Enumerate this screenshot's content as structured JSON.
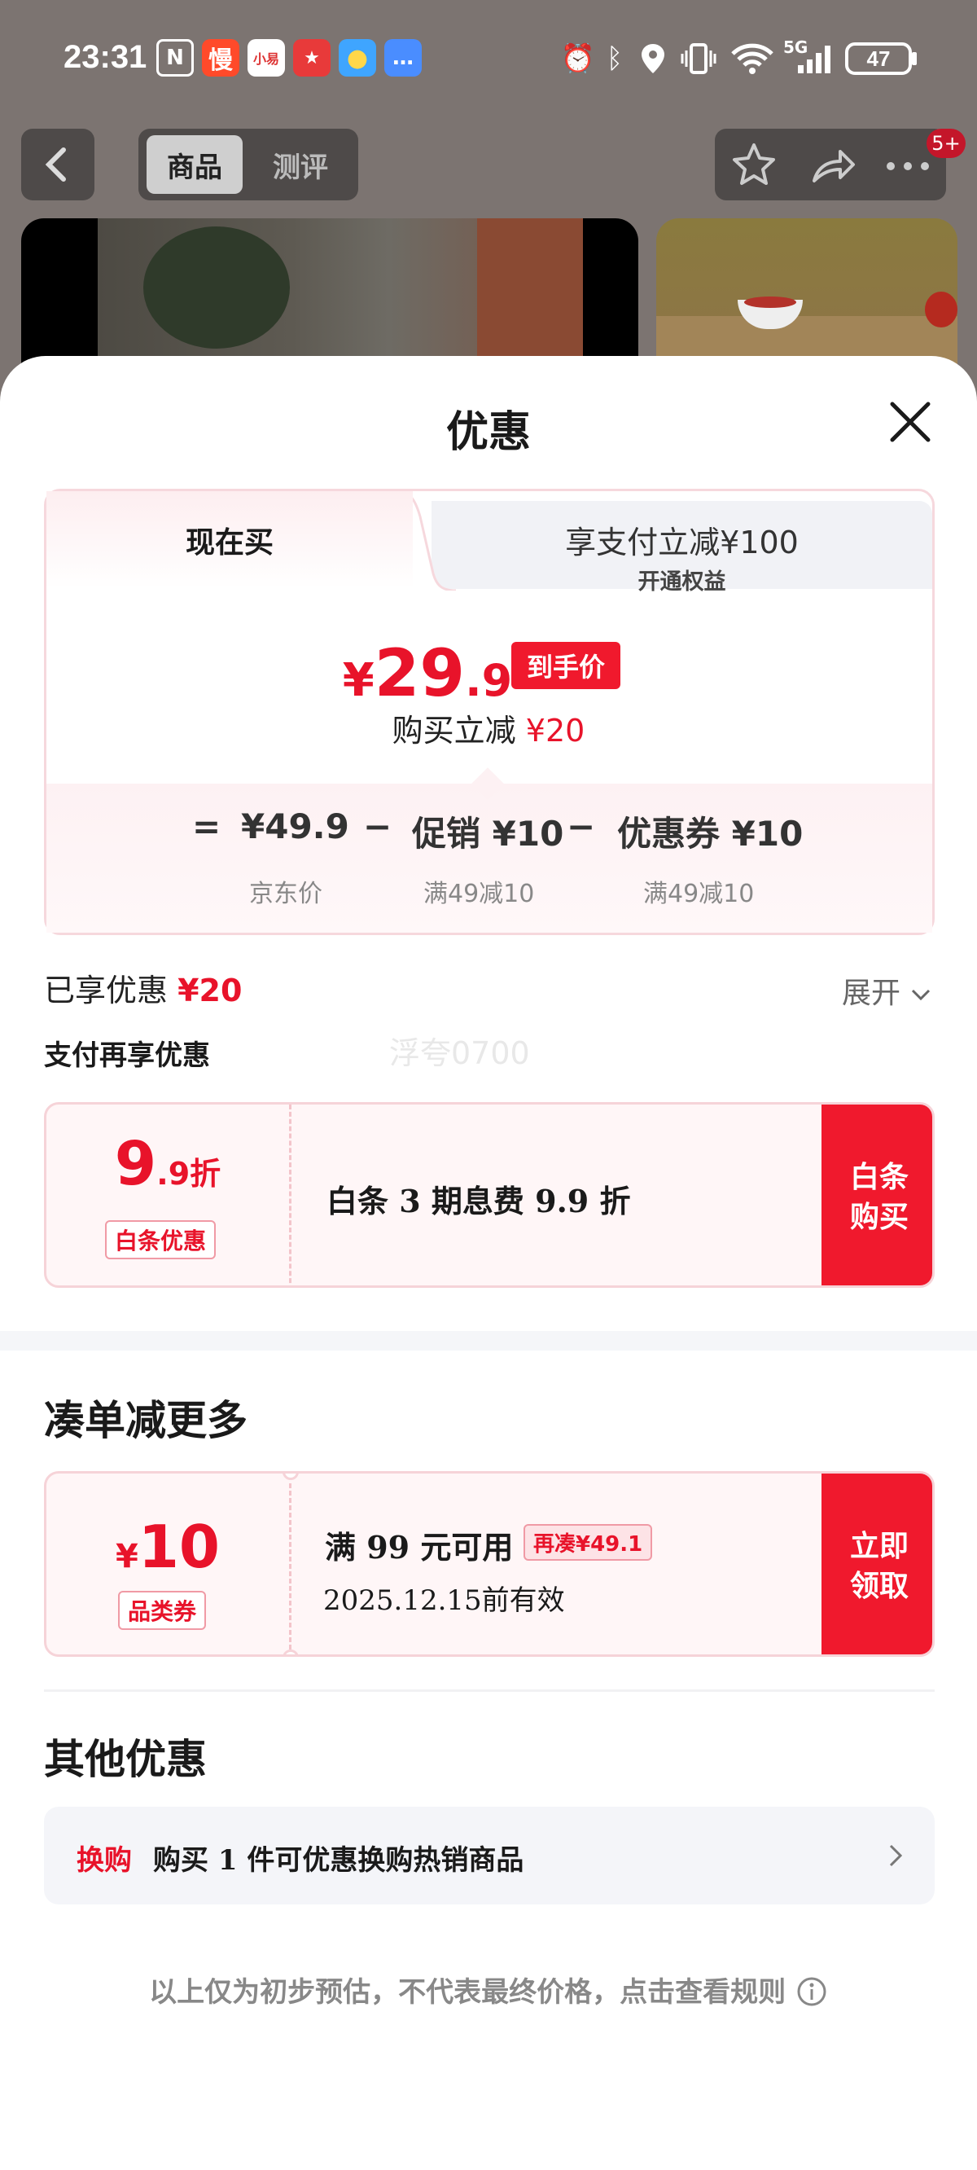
{
  "status_bar": {
    "time": "23:31",
    "apps": [
      "NFC",
      "慢",
      "小易",
      "拼",
      "天气",
      "消息"
    ],
    "network": "5G",
    "battery": "47"
  },
  "header": {
    "tab_product": "商品",
    "tab_review": "测评",
    "badge": "5+"
  },
  "sheet": {
    "title": "优惠",
    "tab_now": "现在买",
    "tab_pay_line1": "享支付立减¥100",
    "tab_pay_line2": "开通权益",
    "price_yen": "¥",
    "price_int": "29",
    "price_dec": ".9",
    "price_tag": "到手价",
    "reduce_label": "购买立减",
    "reduce_value": "¥20",
    "breakdown": {
      "eq": "=",
      "jd_price": "¥49.9",
      "jd_label": "京东价",
      "minus1": "−",
      "promo": "促销 ¥10",
      "promo_label": "满49减10",
      "minus2": "−",
      "coupon": "优惠券 ¥10",
      "coupon_label": "满49减10"
    },
    "enjoyed_label": "已享优惠",
    "enjoyed_value": "¥20",
    "expand": "展开",
    "pay_more": "支付再享优惠",
    "watermark": "浮夸0700"
  },
  "baitiao": {
    "big": "9",
    "small": ".9折",
    "badge": "白条优惠",
    "desc": "白条 3 期息费 9.9 折",
    "button": "白条\n购买"
  },
  "bundle": {
    "title": "凑单减更多",
    "yen": "¥",
    "amount": "10",
    "badge": "品类券",
    "condition": "满 99 元可用",
    "extra": "再凑¥49.1",
    "valid": "2025.12.15前有效",
    "button": "立即\n领取"
  },
  "other": {
    "title": "其他优惠",
    "tag": "换购",
    "text": "购买 1 件可优惠换购热销商品"
  },
  "footer": "以上仅为初步预估，不代表最终价格，点击查看规则",
  "colors": {
    "accent": "#f0192d",
    "price": "#e8132a",
    "card_border": "#f6d3d8"
  }
}
